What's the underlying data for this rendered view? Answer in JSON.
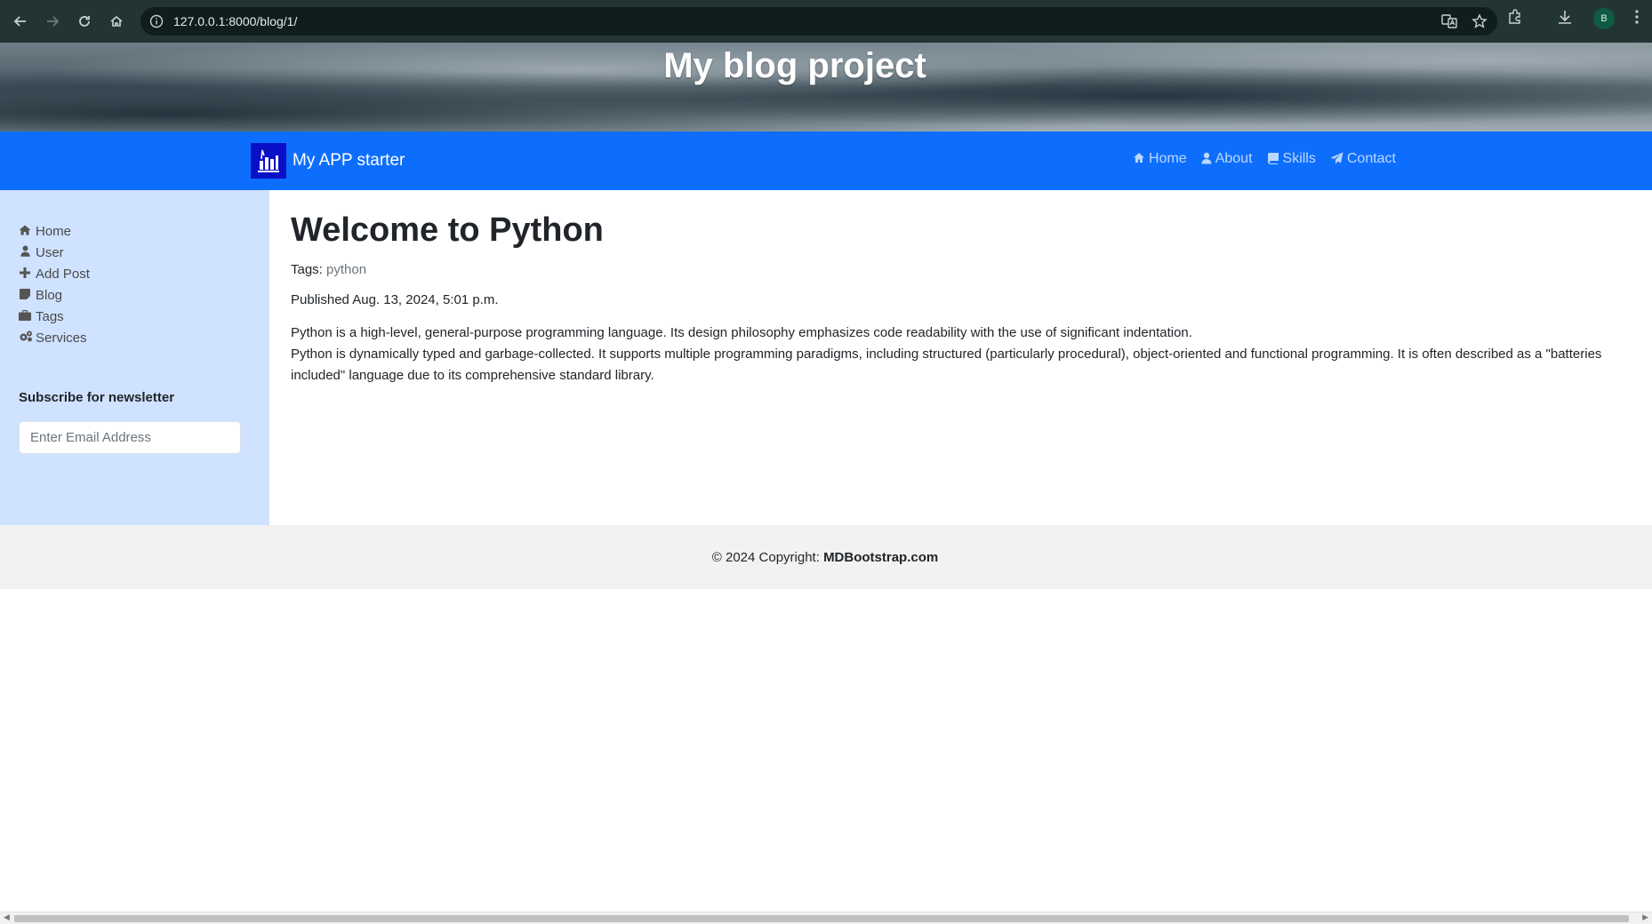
{
  "browser": {
    "url": "127.0.0.1:8000/blog/1/",
    "profile_initial": "B"
  },
  "banner": {
    "title": "My blog project"
  },
  "navbar": {
    "brand": "My APP starter",
    "links": [
      {
        "label": "Home",
        "icon": "home-icon"
      },
      {
        "label": "About",
        "icon": "user-icon"
      },
      {
        "label": "Skills",
        "icon": "book-icon"
      },
      {
        "label": "Contact",
        "icon": "paper-plane-icon"
      }
    ]
  },
  "sidebar": {
    "items": [
      {
        "label": "Home",
        "icon": "home-icon"
      },
      {
        "label": "User",
        "icon": "user-icon"
      },
      {
        "label": "Add Post",
        "icon": "plus-icon"
      },
      {
        "label": "Blog",
        "icon": "note-icon"
      },
      {
        "label": "Tags",
        "icon": "briefcase-icon"
      },
      {
        "label": "Services",
        "icon": "gears-icon"
      }
    ],
    "newsletter_title": "Subscribe for newsletter",
    "email_placeholder": "Enter Email Address"
  },
  "post": {
    "title": "Welcome to Python",
    "tags_label": "Tags:",
    "tag": "python",
    "published": "Published Aug. 13, 2024, 5:01 p.m.",
    "paragraph_1": "Python is a high-level, general-purpose programming language. Its design philosophy emphasizes code readability with the use of significant indentation.",
    "paragraph_2": "Python is dynamically typed and garbage-collected. It supports multiple programming paradigms, including structured (particularly procedural), object-oriented and functional programming. It is often described as a \"batteries included\" language due to its comprehensive standard library."
  },
  "footer": {
    "copyright": "© 2024 Copyright:",
    "brand": "MDBootstrap.com"
  },
  "colors": {
    "navbar": "#0d6efd",
    "sidebar": "#cfe2ff",
    "footer": "#f2f2f2",
    "chrome": "#233435"
  }
}
